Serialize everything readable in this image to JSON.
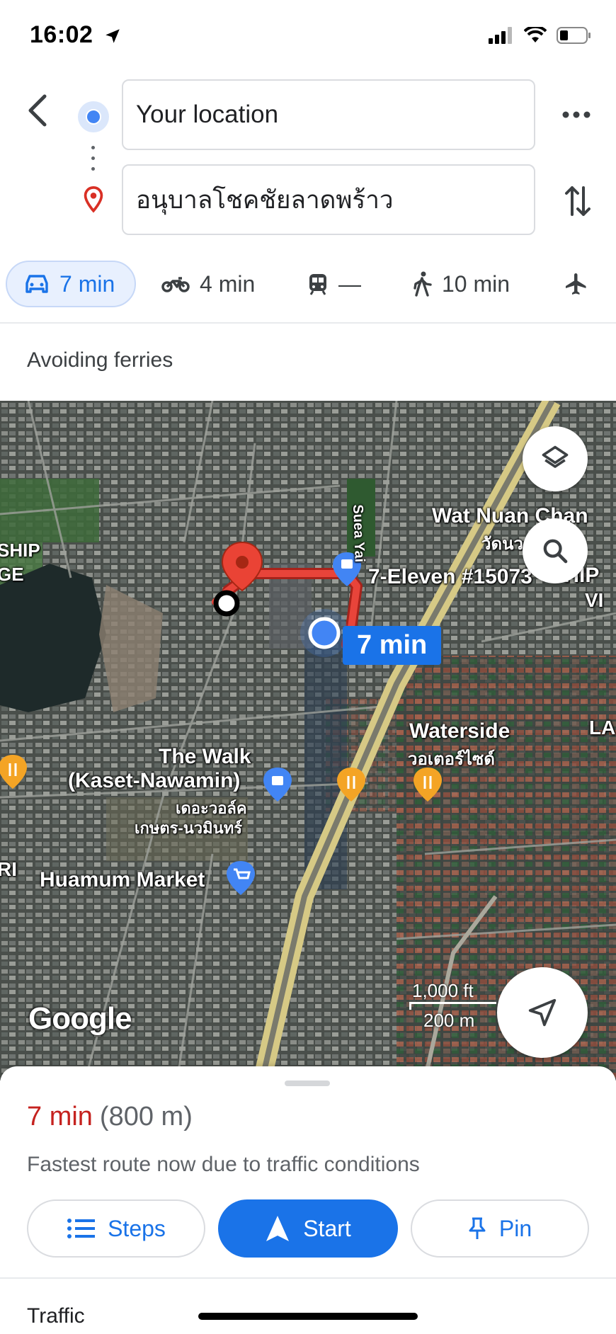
{
  "status_bar": {
    "time": "16:02"
  },
  "directions": {
    "origin": "Your location",
    "destination": "อนุบาลโชคชัยลาดพร้าว"
  },
  "modes": [
    {
      "icon": "car-icon",
      "label": "7 min",
      "active": true
    },
    {
      "icon": "motorcycle-icon",
      "label": "4 min"
    },
    {
      "icon": "transit-icon",
      "label": "—"
    },
    {
      "icon": "walk-icon",
      "label": "10 min"
    },
    {
      "icon": "flight-icon",
      "label": ""
    }
  ],
  "notice": "Avoiding ferries",
  "map": {
    "eta_label": "7 min",
    "labels": {
      "wat_nuan_chan_en": "Wat Nuan Chan",
      "wat_nuan_chan_th": "วัดนวลจันทร์",
      "seven_eleven": "7-Eleven #15073",
      "thip": "THIP",
      "the_walk_en_1": "The Walk",
      "the_walk_en_2": "(Kaset-Nawamin)",
      "the_walk_th_1": "เดอะวอล์ค",
      "the_walk_th_2": "เกษตร-นวมินทร์",
      "waterside_en": "Waterside",
      "waterside_th": "วอเตอร์ไซด์",
      "huamum": "Huamum Market",
      "suea_yai": "Suea Yai",
      "ship": "SHIP",
      "ge": "GE",
      "vi": "VI",
      "la": "LA",
      "ri": "RI"
    },
    "scale_imperial": "1,000 ft",
    "scale_metric": "200 m",
    "logo": "Google"
  },
  "sheet": {
    "time": "7 min",
    "distance": "(800 m)",
    "description": "Fastest route now due to traffic conditions",
    "steps_label": "Steps",
    "start_label": "Start",
    "pin_label": "Pin",
    "section_title": "Traffic"
  },
  "colors": {
    "accent": "#1a73e8",
    "route": "#e8443a",
    "eta_text": "#c5221f"
  }
}
